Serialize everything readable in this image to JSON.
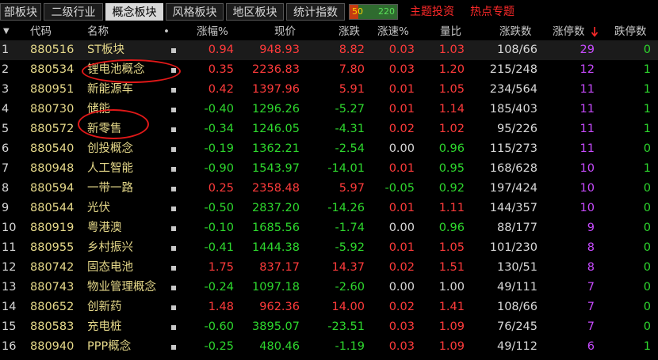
{
  "tabs": [
    {
      "label": "部板块",
      "active": false
    },
    {
      "label": "二级行业",
      "active": false
    },
    {
      "label": "概念板块",
      "active": true
    },
    {
      "label": "风格板块",
      "active": false
    },
    {
      "label": "地区板块",
      "active": false
    },
    {
      "label": "统计指数",
      "active": false
    }
  ],
  "breadth": {
    "up": "50",
    "down": "220"
  },
  "links": {
    "theme": "主题投资",
    "hot": "热点专题"
  },
  "headers": {
    "menu": "▼",
    "code": "代码",
    "name": "名称",
    "dot": "•",
    "pct": "涨幅%",
    "price": "现价",
    "change": "涨跌",
    "speed": "涨速%",
    "volratio": "量比",
    "updown": "涨跌数",
    "limitup": "涨停数",
    "limitdown": "跌停数"
  },
  "colors": {
    "up": "#ff3b3b",
    "down": "#2ed82e",
    "flat": "#d8d8d8",
    "name": "#e6d98a",
    "limitup": "#c84bff",
    "annotation": "#e01818"
  },
  "rows": [
    {
      "idx": "1",
      "code": "880516",
      "name": "ST板块",
      "pct": "0.94",
      "price": "948.93",
      "change": "8.82",
      "speed": "0.03",
      "volratio": "1.03",
      "updown": "108/66",
      "limitup": "29",
      "limitdown": "0"
    },
    {
      "idx": "2",
      "code": "880534",
      "name": "锂电池概念",
      "pct": "0.35",
      "price": "2236.83",
      "change": "7.80",
      "speed": "0.03",
      "volratio": "1.20",
      "updown": "215/248",
      "limitup": "12",
      "limitdown": "1"
    },
    {
      "idx": "3",
      "code": "880951",
      "name": "新能源车",
      "pct": "0.42",
      "price": "1397.96",
      "change": "5.91",
      "speed": "0.01",
      "volratio": "1.05",
      "updown": "234/564",
      "limitup": "11",
      "limitdown": "1"
    },
    {
      "idx": "4",
      "code": "880730",
      "name": "储能",
      "pct": "-0.40",
      "price": "1296.26",
      "change": "-5.27",
      "speed": "0.01",
      "volratio": "1.14",
      "updown": "185/403",
      "limitup": "11",
      "limitdown": "1"
    },
    {
      "idx": "5",
      "code": "880572",
      "name": "新零售",
      "pct": "-0.34",
      "price": "1246.05",
      "change": "-4.31",
      "speed": "0.02",
      "volratio": "1.02",
      "updown": "95/226",
      "limitup": "11",
      "limitdown": "1"
    },
    {
      "idx": "6",
      "code": "880540",
      "name": "创投概念",
      "pct": "-0.19",
      "price": "1362.21",
      "change": "-2.54",
      "speed": "0.00",
      "volratio": "0.96",
      "updown": "115/273",
      "limitup": "11",
      "limitdown": "0"
    },
    {
      "idx": "7",
      "code": "880948",
      "name": "人工智能",
      "pct": "-0.90",
      "price": "1543.97",
      "change": "-14.01",
      "speed": "0.01",
      "volratio": "0.95",
      "updown": "168/628",
      "limitup": "10",
      "limitdown": "1"
    },
    {
      "idx": "8",
      "code": "880594",
      "name": "一带一路",
      "pct": "0.25",
      "price": "2358.48",
      "change": "5.97",
      "speed": "-0.05",
      "volratio": "0.92",
      "updown": "197/424",
      "limitup": "10",
      "limitdown": "0"
    },
    {
      "idx": "9",
      "code": "880544",
      "name": "光伏",
      "pct": "-0.50",
      "price": "2837.20",
      "change": "-14.26",
      "speed": "0.01",
      "volratio": "1.11",
      "updown": "144/357",
      "limitup": "10",
      "limitdown": "0"
    },
    {
      "idx": "10",
      "code": "880919",
      "name": "粤港澳",
      "pct": "-0.10",
      "price": "1685.56",
      "change": "-1.74",
      "speed": "0.00",
      "volratio": "0.96",
      "updown": "88/177",
      "limitup": "9",
      "limitdown": "0"
    },
    {
      "idx": "11",
      "code": "880955",
      "name": "乡村振兴",
      "pct": "-0.41",
      "price": "1444.38",
      "change": "-5.92",
      "speed": "0.01",
      "volratio": "1.05",
      "updown": "101/230",
      "limitup": "8",
      "limitdown": "0"
    },
    {
      "idx": "12",
      "code": "880742",
      "name": "固态电池",
      "pct": "1.75",
      "price": "837.17",
      "change": "14.37",
      "speed": "0.02",
      "volratio": "1.51",
      "updown": "130/51",
      "limitup": "8",
      "limitdown": "0"
    },
    {
      "idx": "13",
      "code": "880743",
      "name": "物业管理概念",
      "pct": "-0.24",
      "price": "1097.18",
      "change": "-2.60",
      "speed": "0.00",
      "volratio": "1.00",
      "updown": "49/111",
      "limitup": "7",
      "limitdown": "0"
    },
    {
      "idx": "14",
      "code": "880652",
      "name": "创新药",
      "pct": "1.48",
      "price": "962.36",
      "change": "14.00",
      "speed": "0.02",
      "volratio": "1.41",
      "updown": "108/66",
      "limitup": "7",
      "limitdown": "0"
    },
    {
      "idx": "15",
      "code": "880583",
      "name": "充电桩",
      "pct": "-0.60",
      "price": "3895.07",
      "change": "-23.51",
      "speed": "0.03",
      "volratio": "1.09",
      "updown": "76/245",
      "limitup": "7",
      "limitdown": "0"
    },
    {
      "idx": "16",
      "code": "880940",
      "name": "PPP概念",
      "pct": "-0.25",
      "price": "480.46",
      "change": "-1.19",
      "speed": "0.03",
      "volratio": "1.09",
      "updown": "49/112",
      "limitup": "6",
      "limitdown": "1"
    }
  ]
}
